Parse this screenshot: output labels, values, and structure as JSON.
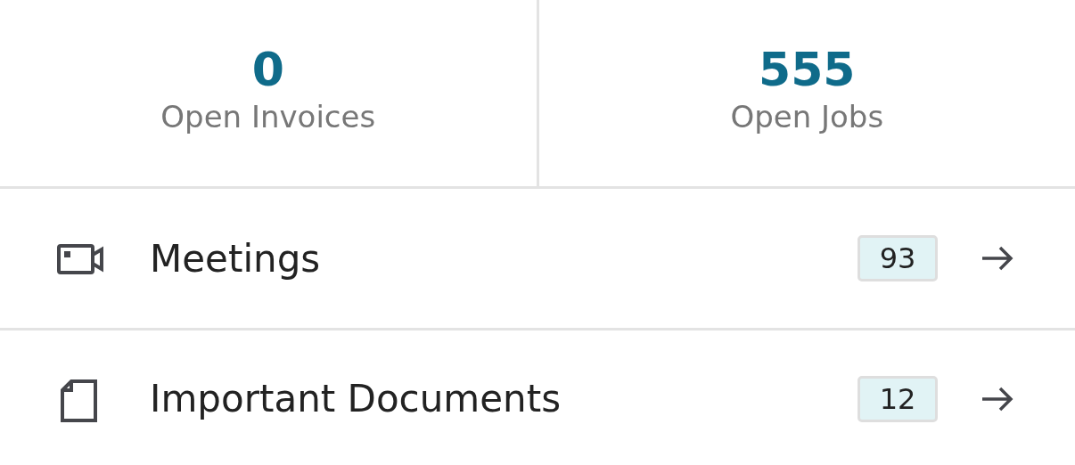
{
  "stats": [
    {
      "value": "0",
      "label": "Open Invoices"
    },
    {
      "value": "555",
      "label": "Open Jobs"
    }
  ],
  "items": [
    {
      "kind": "video",
      "label": "Meetings",
      "count": "93"
    },
    {
      "kind": "document",
      "label": "Important Documents",
      "count": "12"
    }
  ]
}
